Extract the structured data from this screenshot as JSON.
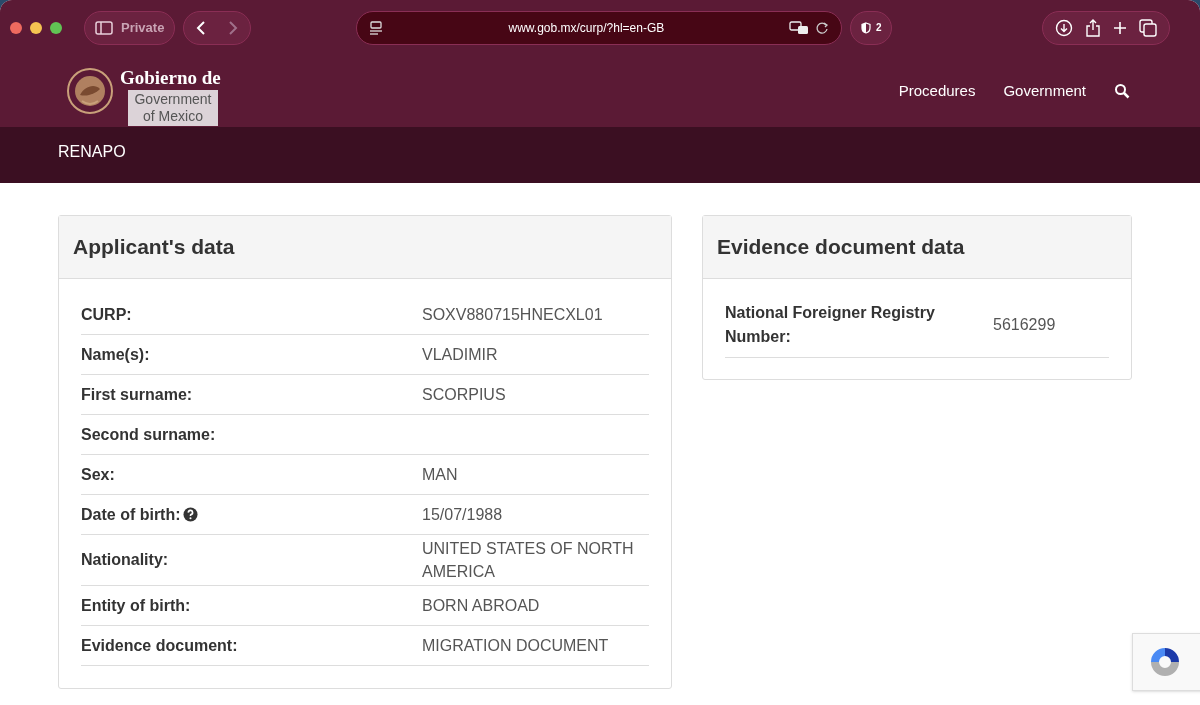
{
  "browser": {
    "private_label": "Private",
    "url": "www.gob.mx/curp/?hl=en-GB",
    "blocked_count": "2"
  },
  "site": {
    "logo_lines": [
      "Gobierno de"
    ],
    "translation_overlay": "Government of Mexico",
    "nav": [
      "Procedures",
      "Government"
    ],
    "section": "RENAPO"
  },
  "applicant": {
    "title": "Applicant's data",
    "rows": [
      {
        "label": "CURP:",
        "value": "SOXV880715HNECXL01",
        "help": false
      },
      {
        "label": "Name(s):",
        "value": "VLADIMIR",
        "help": false
      },
      {
        "label": "First surname:",
        "value": "SCORPIUS",
        "help": false
      },
      {
        "label": "Second surname:",
        "help": false
      },
      {
        "label": "Sex:",
        "value": "MAN",
        "help": false
      },
      {
        "label": "Date of birth:",
        "value": "15/07/1988",
        "help": true
      },
      {
        "label": "Nationality:",
        "value": "UNITED STATES OF NORTH AMERICA",
        "help": false
      },
      {
        "label": "Entity of birth:",
        "value": "BORN ABROAD",
        "help": false
      },
      {
        "label": "Evidence document:",
        "value": "MIGRATION DOCUMENT",
        "help": false
      }
    ]
  },
  "evidence": {
    "title": "Evidence document data",
    "rows": [
      {
        "label": "National Foreigner Registry Number:",
        "value": "5616299"
      }
    ]
  }
}
